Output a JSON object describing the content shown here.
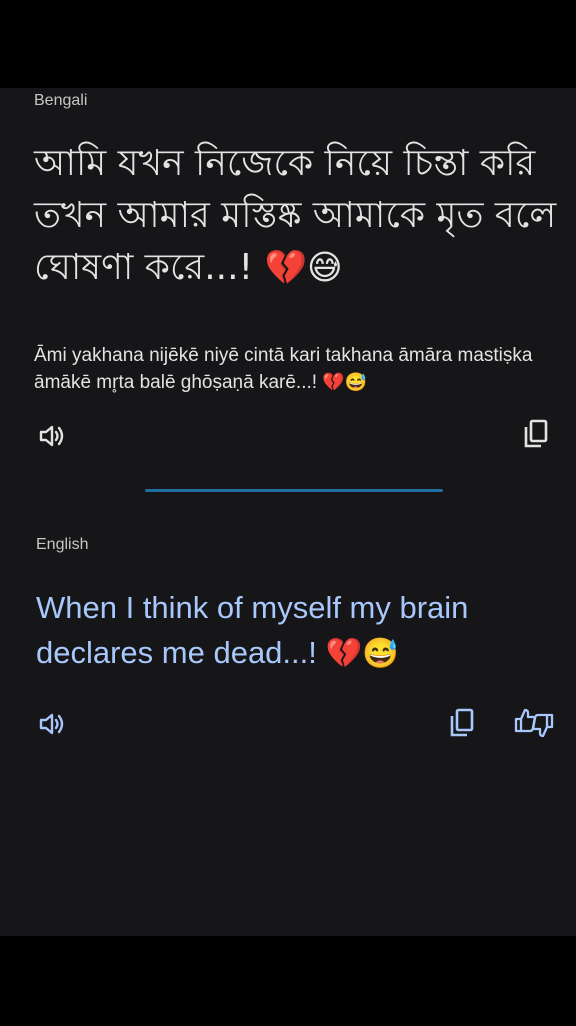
{
  "source": {
    "language": "Bengali",
    "text": "আমি যখন নিজেকে নিয়ে চিন্তা করি তখন আমার মস্তিষ্ক আমাকে মৃত বলে ঘোষণা করে...!",
    "emojis": "💔😅",
    "transliteration": "Āmi yakhana nijēkē niyē cintā kari takhana āmāra mastiṣka āmākē mr̥ta balē ghōṣaṇā karē...!",
    "transliteration_emojis": "💔😅"
  },
  "target": {
    "language": "English",
    "text": "When I think of myself my brain declares me dead...!",
    "emojis": " 💔😅"
  },
  "icons": {
    "listen_source": "speaker-icon",
    "copy_source": "copy-icon",
    "listen_target": "speaker-icon",
    "copy_target": "copy-icon",
    "feedback": "rate-translation-icon"
  },
  "colors": {
    "background": "#000000",
    "card": "#161618",
    "text": "#e3e3e3",
    "accent": "#a8c7fa",
    "divider": "#1f6fa3"
  }
}
